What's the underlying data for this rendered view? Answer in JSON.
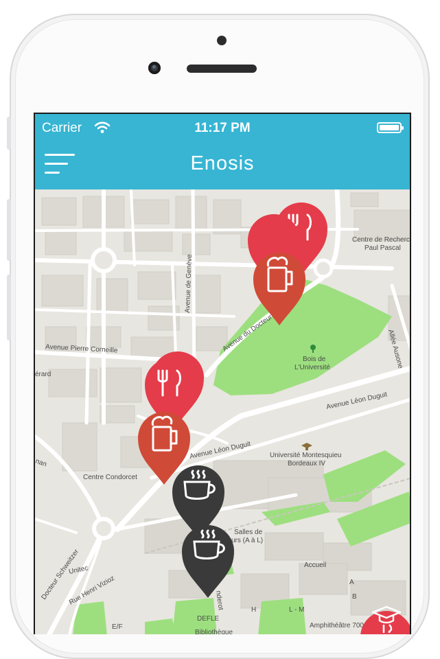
{
  "status_bar": {
    "carrier": "Carrier",
    "time": "11:17 PM"
  },
  "app": {
    "title": "Enosis",
    "accent_color": "#37b5d3"
  },
  "map": {
    "labels": {
      "centre_recherche_1": "Centre de Recherche",
      "centre_recherche_2": "Paul Pascal",
      "avenue_geneve": "Avenue de Genève",
      "avenue_docteur": "Avenue du Docteur",
      "bois_1": "Bois de",
      "bois_2": "L'Université",
      "allee_ausone": "Allée Ausone",
      "avenue_corneille": "Avenue Pierre Corneille",
      "gerard": "érard",
      "avenue_duguit_1": "Avenue Léon Duguit",
      "avenue_duguit_2": "Avenue Léon Duguit",
      "universite_1": "Université Montesquieu",
      "universite_2": "Bordeaux IV",
      "nan": "nan",
      "centre_condorcet": "Centre Condorcet",
      "docteur_schweitzer": "Docteur Schweitzer",
      "unitec": "Unitec",
      "rue_viziow": "Rue Henri Vizioz",
      "salles_1": "Salles de",
      "salles_2": "urs (A à L)",
      "accueil": "Accueil",
      "defle": "DEFLE",
      "bibliotheque": "Bibliothèque",
      "e_f": "E/F",
      "h": "H",
      "l_m": "L - M",
      "amphi": "Amphithéâtre 700",
      "a": "A",
      "b": "B",
      "nderot": "nderot"
    },
    "markers": [
      {
        "category": "restaurant",
        "icon": "fork-knife-icon",
        "color": "#e43c4a"
      },
      {
        "category": "bar",
        "icon": "beer-mug-icon",
        "color": "#e43c4a"
      },
      {
        "category": "bar",
        "icon": "beer-mug-icon",
        "color": "#d04a38"
      },
      {
        "category": "restaurant",
        "icon": "fork-knife-icon",
        "color": "#e43c4a"
      },
      {
        "category": "restaurant",
        "icon": "fork-knife-icon",
        "color": "#e43c4a"
      },
      {
        "category": "bar",
        "icon": "beer-mug-icon",
        "color": "#d04a38"
      },
      {
        "category": "cafe",
        "icon": "coffee-cup-icon",
        "color": "#3a3a3a"
      },
      {
        "category": "cafe",
        "icon": "coffee-cup-icon",
        "color": "#3a3a3a"
      },
      {
        "category": "university",
        "icon": "graduation-cap-icon",
        "color": "#e43c4a"
      }
    ]
  }
}
